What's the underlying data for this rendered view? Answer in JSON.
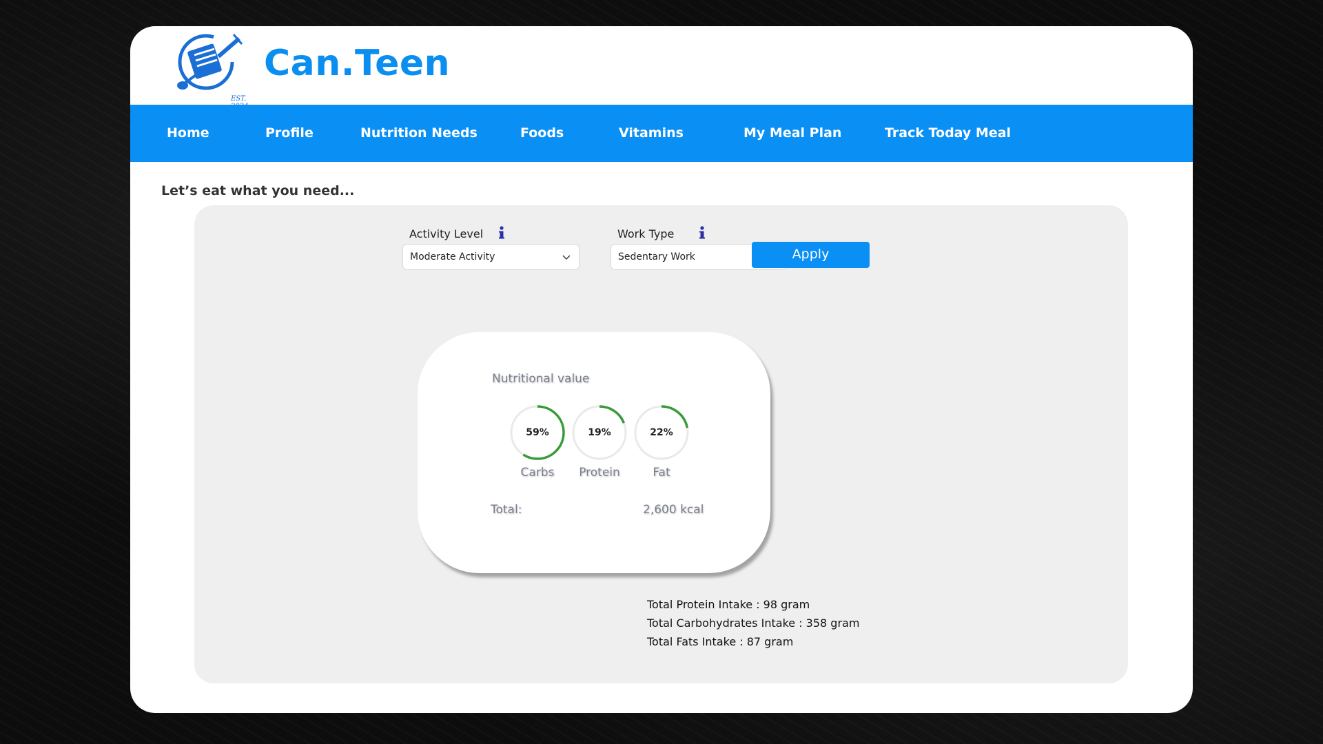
{
  "app": {
    "brand": "Can.Teen",
    "logo_text": "EST. 2024"
  },
  "nav": {
    "items": [
      {
        "label": "Home"
      },
      {
        "label": "Profile"
      },
      {
        "label": "Nutrition Needs"
      },
      {
        "label": "Foods"
      },
      {
        "label": "Vitamins"
      },
      {
        "label": "My Meal Plan"
      },
      {
        "label": "Track Today Meal"
      }
    ]
  },
  "main": {
    "tagline": "Let’s eat what you need...",
    "activity": {
      "label": "Activity Level",
      "value": "Moderate Activity",
      "icon": "info-icon"
    },
    "work": {
      "label": "Work Type",
      "value": "Sedentary Work",
      "icon": "info-icon"
    },
    "apply_label": "Apply"
  },
  "nutrition_card": {
    "title": "Nutritional value",
    "macros": [
      {
        "name": "Carbs",
        "percent_label": "59%",
        "percent": 59
      },
      {
        "name": "Protein",
        "percent_label": "19%",
        "percent": 19
      },
      {
        "name": "Fat",
        "percent_label": "22%",
        "percent": 22
      }
    ],
    "total_label": "Total:",
    "total_value": "2,600 kcal"
  },
  "intake": {
    "protein": "Total Protein Intake : 98 gram",
    "carbs": "Total Carbohydrates Intake : 358 gram",
    "fats": "Total Fats Intake : 87 gram"
  },
  "colors": {
    "accent": "#0a8ff5",
    "brand": "#0a8ff0",
    "ring_progress": "#3a9a3a",
    "panel": "#efefef"
  }
}
